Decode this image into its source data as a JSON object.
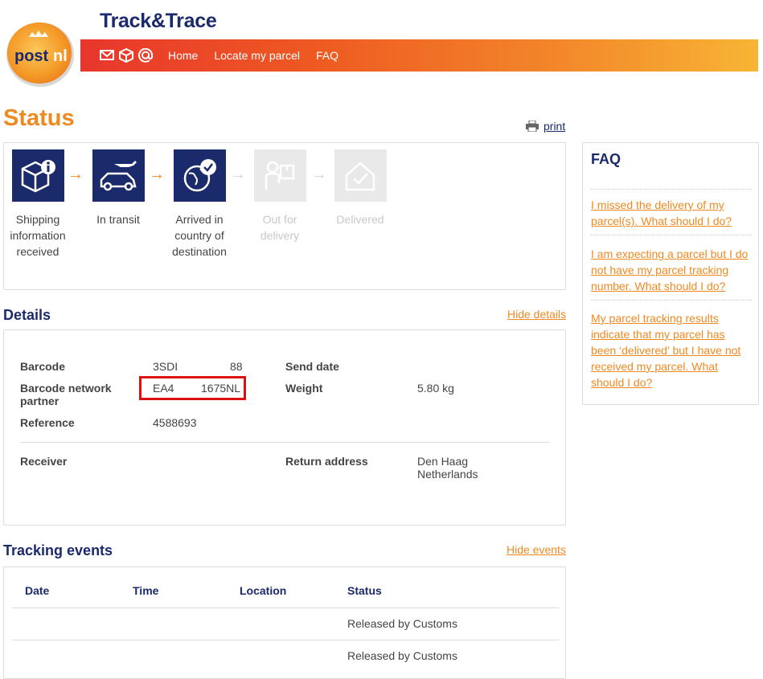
{
  "header": {
    "title": "Track&Trace",
    "logo_text": "postnl",
    "nav": [
      {
        "label": "Home"
      },
      {
        "label": "Locate my parcel"
      },
      {
        "label": "FAQ"
      }
    ],
    "nav_icons": [
      "mail-icon",
      "parcel-icon",
      "email-at-icon"
    ],
    "colors": {
      "brand_orange": "#ee8a22",
      "brand_navy": "#1b2a6b",
      "nav_gradient_start": "#e8362d",
      "nav_gradient_end": "#f7b535"
    }
  },
  "status": {
    "heading": "Status",
    "print_label": "print",
    "steps": [
      {
        "label_lines": [
          "Shipping",
          "information",
          "received"
        ],
        "icon": "box-info-icon",
        "active": true
      },
      {
        "label_lines": [
          "In transit"
        ],
        "icon": "plane-van-icon",
        "active": true
      },
      {
        "label_lines": [
          "Arrived in",
          "country of",
          "destination"
        ],
        "icon": "globe-check-icon",
        "active": true
      },
      {
        "label_lines": [
          "Out for",
          "delivery"
        ],
        "icon": "courier-icon",
        "active": false
      },
      {
        "label_lines": [
          "Delivered"
        ],
        "icon": "house-check-icon",
        "active": false
      }
    ]
  },
  "details": {
    "heading": "Details",
    "toggle_label": "Hide details",
    "barcode_label": "Barcode",
    "barcode_value_start": "3SDI",
    "barcode_value_end": "88",
    "network_label_line1": "Barcode network",
    "network_label_line2": "partner",
    "network_value_start": "EA4",
    "network_value_end": "1675NL",
    "reference_label": "Reference",
    "reference_value": "4588693",
    "send_date_label": "Send date",
    "weight_label": "Weight",
    "weight_value": "5.80 kg",
    "receiver_label": "Receiver",
    "return_label": "Return address",
    "return_city": "Den Haag",
    "return_country": "Netherlands"
  },
  "tracking": {
    "heading": "Tracking events",
    "toggle_label": "Hide events",
    "columns": [
      "Date",
      "Time",
      "Location",
      "Status"
    ],
    "rows": [
      {
        "status": "Released by Customs"
      },
      {
        "status": "Released by Customs"
      }
    ]
  },
  "faq": {
    "title": "FAQ",
    "items": [
      {
        "line1": "I missed the delivery of my",
        "line2": "parcel(s). What should I do?"
      },
      {
        "line1": "I am expecting a parcel but I do",
        "line2": "not have my parcel tracking",
        "line3": "number. What should I do?"
      },
      {
        "line1": "My parcel tracking results",
        "line2": "indicate that my parcel has",
        "line3": "been ‘delivered’ but I have not",
        "line4": "received my parcel. What",
        "line5": "should I do?"
      }
    ]
  }
}
